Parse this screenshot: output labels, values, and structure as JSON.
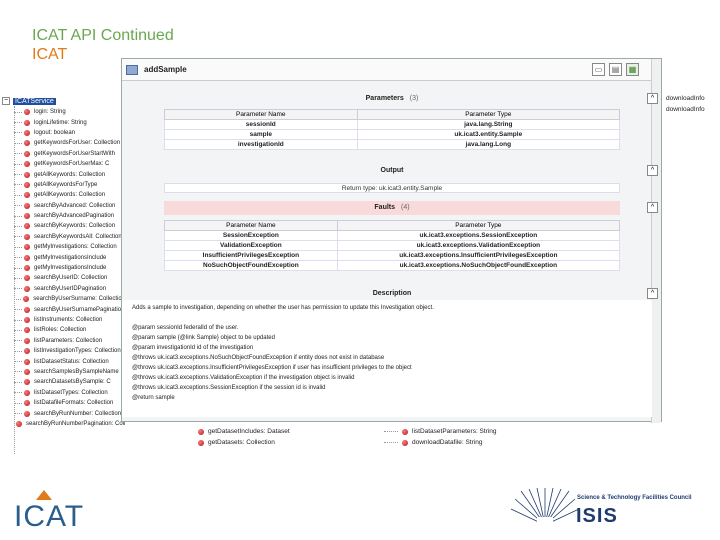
{
  "slide": {
    "title": "ICAT API Continued",
    "subtitle": "ICAT"
  },
  "window": {
    "title": "addSample",
    "parameters": {
      "heading": "Parameters",
      "count": "(3)",
      "col_name": "Parameter Name",
      "col_type": "Parameter Type",
      "rows": [
        {
          "name": "sessionId",
          "type": "java.lang.String"
        },
        {
          "name": "sample",
          "type": "uk.icat3.entity.Sample"
        },
        {
          "name": "investigationId",
          "type": "java.lang.Long"
        }
      ]
    },
    "output": {
      "heading": "Output",
      "return_type": "Return type: uk.icat3.entity.Sample"
    },
    "faults": {
      "heading": "Faults",
      "count": "(4)",
      "col_name": "Parameter Name",
      "col_type": "Parameter Type",
      "rows": [
        {
          "name": "SessionException",
          "type": "uk.icat3.exceptions.SessionException"
        },
        {
          "name": "ValidationException",
          "type": "uk.icat3.exceptions.ValidationException"
        },
        {
          "name": "InsufficientPrivilegesException",
          "type": "uk.icat3.exceptions.InsufficientPrivilegesException"
        },
        {
          "name": "NoSuchObjectFoundException",
          "type": "uk.icat3.exceptions.NoSuchObjectFoundException"
        }
      ]
    },
    "description": {
      "heading": "Description",
      "lines": [
        "Adds a sample to investigation, depending on whether the user has permission to update this Investigation object.",
        "",
        "@param sessionId federalId of the user.",
        "@param sample {@link Sample} object to be updated",
        "@param investigationId id of the investigation",
        "@throws uk.icat3.exceptions.NoSuchObjectFoundException if entity does not exist in database",
        "@throws uk.icat3.exceptions.InsufficientPrivilegesException if user has insufficient privileges to the object",
        "@throws uk.icat3.exceptions.ValidationException if the investigation object is invalid",
        "@throws uk.icat3.exceptions.SessionException if the session id is invalid",
        "@return sample"
      ]
    }
  },
  "tree": {
    "root": "ICATService",
    "items": [
      "login: String",
      "loginLifetime: String",
      "logout: boolean",
      "getKeywordsForUser: Collection",
      "getKeywordsForUserStartWith",
      "getKeywordsForUserMax: C",
      "getAllKeywords: Collection",
      "getAllKeywordsForType",
      "getAllKeywords: Collection",
      "searchByAdvanced: Collection",
      "searchByAdvancedPagination",
      "searchByKeywords: Collection",
      "searchByKeywordsAll: Collection",
      "getMyInvestigations: Collection",
      "getMyInvestigationsInclude",
      "getMyInvestigationsInclude",
      "searchByUserID: Collection",
      "searchByUserIDPagination",
      "searchByUserSurname: Collection",
      "searchByUserSurnamePagination",
      "listInstruments: Collection",
      "listRoles: Collection",
      "listParameters: Collection",
      "listInvestigationTypes: Collection",
      "listDatasetStatus: Collection",
      "searchSamplesBySampleName",
      "searchDatasetsBySample: C",
      "listDatasetTypes: Collection",
      "listDatafileFormats: Collection",
      "searchByRunNumber: Collection",
      "searchByRunNumberPagination: Collection"
    ]
  },
  "right_clip": [
    "downloadInfo",
    "downloadInfo"
  ],
  "bottom_row": [
    {
      "label": "getDatasetIncludes: Dataset"
    },
    {
      "label": "getDatasets: Collection"
    },
    {
      "label": "listDatasetParameters: String"
    },
    {
      "label": "downloadDatafile: String"
    }
  ],
  "logos": {
    "left": "ICAT",
    "right_line1": "Science & Technology Facilities Council",
    "right_line2": "ISIS"
  }
}
